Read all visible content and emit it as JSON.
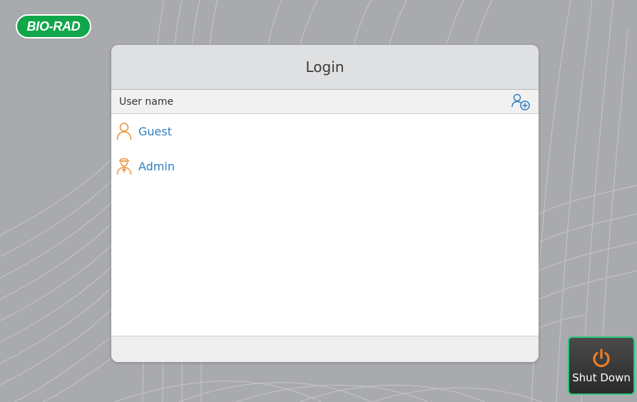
{
  "brand": {
    "logo_text": "BIO-RAD",
    "color": "#11a64a"
  },
  "login": {
    "title": "Login",
    "column_header": "User name",
    "add_user_icon": "add-user-icon",
    "users": [
      {
        "name": "Guest",
        "icon": "user-icon"
      },
      {
        "name": "Admin",
        "icon": "admin-user-icon"
      }
    ]
  },
  "shutdown": {
    "label": "Shut Down",
    "icon": "power-icon"
  },
  "colors": {
    "user_text": "#2f7fc0",
    "user_icon": "#f0923a",
    "add_user_icon": "#2f7fc0",
    "power_icon": "#f07d22",
    "shutdown_border": "#2fc57a"
  }
}
